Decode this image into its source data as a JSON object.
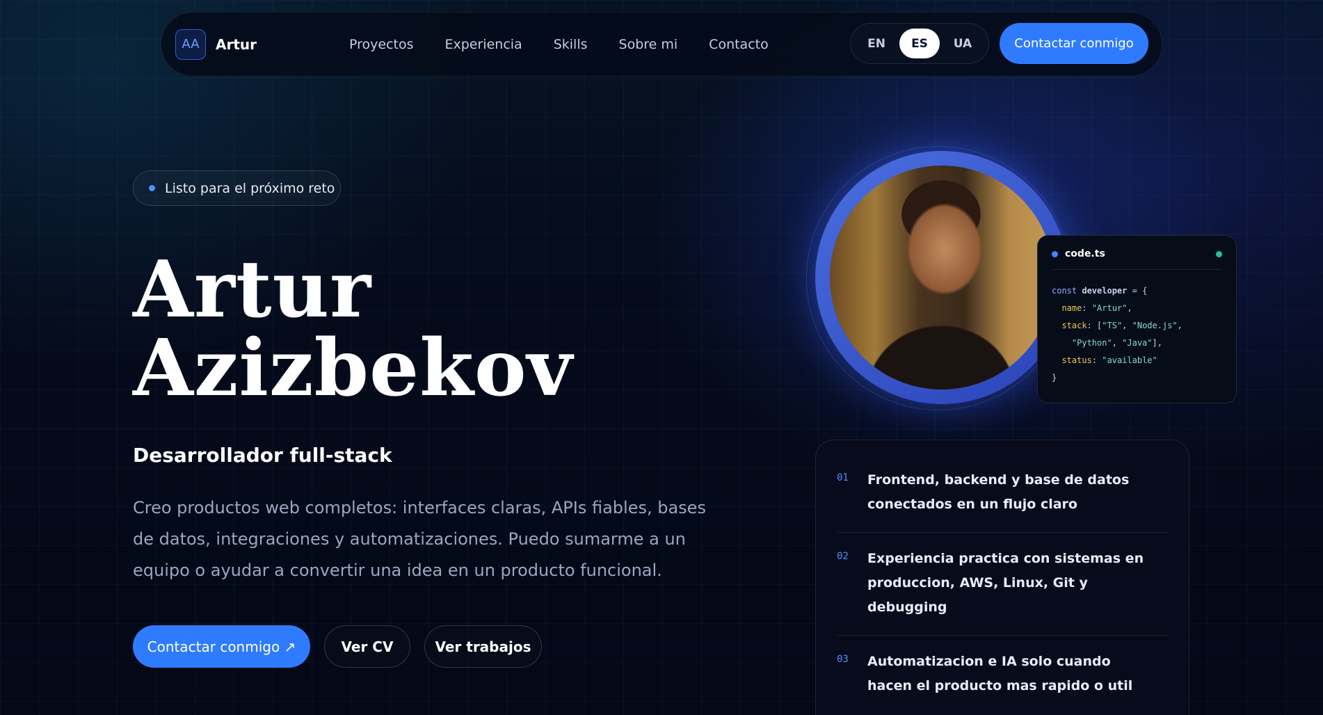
{
  "nav": {
    "brand_mark": "AA",
    "brand_name": "Artur",
    "links": [
      "Proyectos",
      "Experiencia",
      "Skills",
      "Sobre mi",
      "Contacto"
    ],
    "languages": [
      "EN",
      "ES",
      "UA"
    ],
    "active_language": "ES",
    "cta": "Contactar conmigo"
  },
  "hero": {
    "status": "Listo para el próximo reto",
    "first_name": "Artur",
    "last_name": "Azizbekov",
    "role": "Desarrollador full-stack",
    "description": "Creo productos web completos: interfaces claras, APIs fiables, bases de datos, integraciones y automatizaciones. Puedo sumarme a un equipo o ayudar a convertir una idea en un producto funcional.",
    "buttons": {
      "contact": "Contactar conmigo ↗",
      "cv": "Ver CV",
      "work": "Ver trabajos"
    }
  },
  "code_card": {
    "filename": "code.ts"
  },
  "features": [
    {
      "num": "01",
      "text": "Frontend, backend y base de datos conectados en un flujo claro"
    },
    {
      "num": "02",
      "text": "Experiencia practica con sistemas en produccion, AWS, Linux, Git y debugging"
    },
    {
      "num": "03",
      "text": "Automatizacion e IA solo cuando hacen el producto mas rapido o util"
    }
  ],
  "colors": {
    "accent": "#2f7bff",
    "background": "#050b1b",
    "status_dot": "#4f8fff",
    "code_ok": "#25c28f"
  }
}
